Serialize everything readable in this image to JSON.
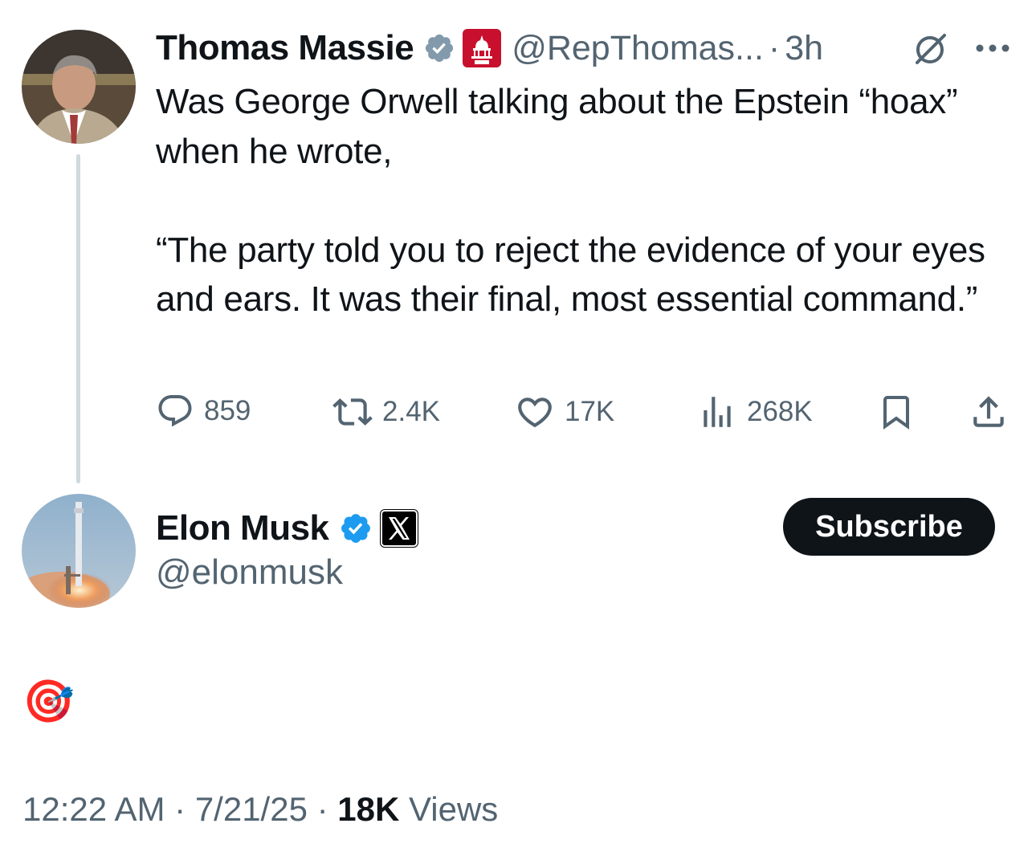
{
  "original_tweet": {
    "author_name": "Thomas Massie",
    "handle": "@RepThomas...",
    "separator": "·",
    "time": "3h",
    "badge_text": "HOUSE GOP",
    "text": "Was George Orwell talking about the Epstein “hoax” when he wrote,\n\n“The party told you to reject the evidence of your eyes and ears. It was their final, most essential command.”",
    "replies": "859",
    "reposts": "2.4K",
    "likes": "17K",
    "views": "268K",
    "icons": [
      "verified-gray-icon",
      "house-gop-badge-icon",
      "grok-icon",
      "more-icon",
      "reply-icon",
      "repost-icon",
      "like-icon",
      "views-icon",
      "bookmark-icon",
      "share-icon"
    ]
  },
  "reply_tweet": {
    "author_name": "Elon Musk",
    "handle": "@elonmusk",
    "subscribe_label": "Subscribe",
    "text": "🎯",
    "time": "12:22 AM",
    "date": "7/21/25",
    "separator": "·",
    "views_count": "18K",
    "views_label": "Views",
    "icons": [
      "verified-blue-icon",
      "x-logo-badge-icon"
    ]
  },
  "colors": {
    "text_primary": "#0f1419",
    "text_secondary": "#536471",
    "verified_blue": "#1d9bf0",
    "verified_gray": "#829aab",
    "gop_red": "#c8102e",
    "thread_line": "#cfd9de"
  }
}
